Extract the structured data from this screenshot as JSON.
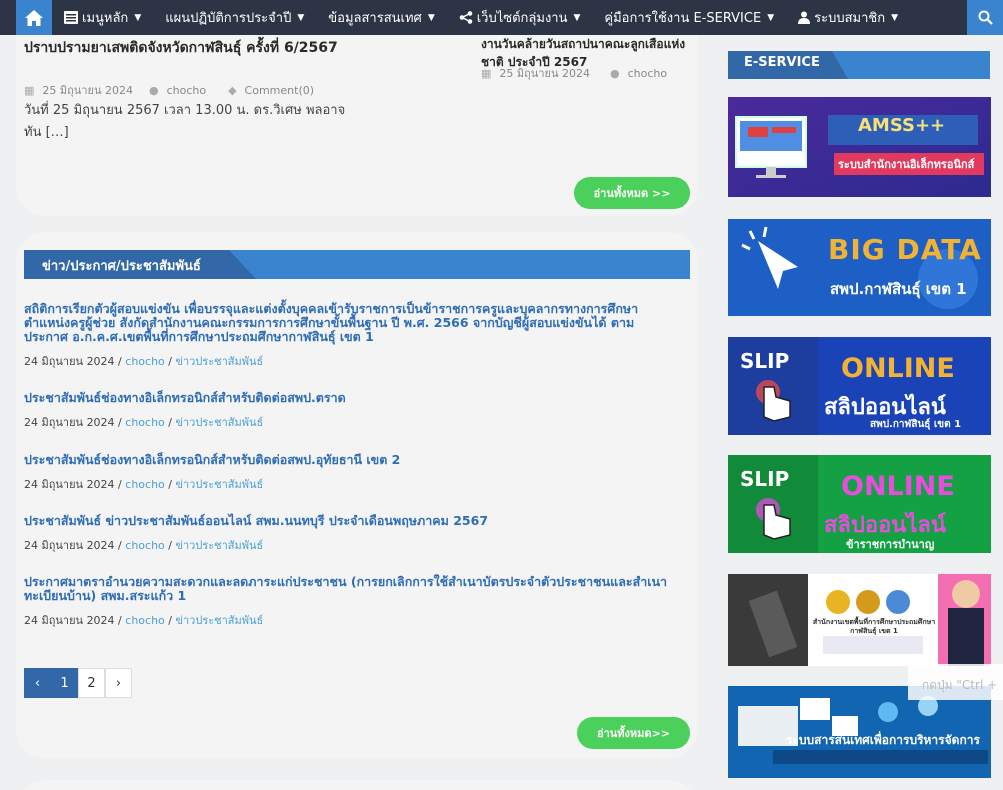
{
  "nav": {
    "items": [
      {
        "label": "เมนูหลัก",
        "icon": "list-icon"
      },
      {
        "label": "แผนปฏิบัติการประจำปี"
      },
      {
        "label": "ข้อมูลสารสนเทศ"
      },
      {
        "label": "เว็บไซต์กลุ่มงาน",
        "icon": "share-icon"
      },
      {
        "label": "คู่มือการใช้งาน E-SERVICE"
      },
      {
        "label": "ระบบสมาชิก",
        "icon": "user-icon"
      }
    ]
  },
  "top": {
    "left_title": "ปราบปรามยาเสพติดจังหวัดกาฬสินธุ์ ครั้งที่ 6/2567",
    "left_date": "25 มิถุนายน 2024",
    "left_author": "chocho",
    "left_comment": "Comment(0)",
    "left_excerpt": "วันที่ 25 มิถุนายน 2567 เวลา 13.00 น. ดร.วิเศษ พลอาจ ทัน […]",
    "right_title": "งานวันคล้ายวันสถาปนาคณะลูกเสือแห่งชาติ ประจำปี 2567",
    "right_date": "25 มิถุนายน 2024",
    "right_author": "chocho",
    "read_all": "อ่านทั้งหมด >>"
  },
  "news_section": {
    "title": "ข่าว/ประกาศ/ประชาสัมพันธ์",
    "items": [
      {
        "title": "สถิติการเรียกตัวผู้สอบแข่งขัน เพื่อบรรจุและแต่งตั้งบุคคลเข้ารับราชการเป็นข้าราชการครูและบุคลากรทางการศึกษา ตำแหน่งครูผู้ช่วย สังกัดสำนักงานคณะกรรมการการศึกษาขั้นพื้นฐาน ปี พ.ศ. 2566 จากบัญชีผู้สอบแข่งขันได้ ตามประกาศ อ.ก.ค.ศ.เขตพื้นที่การศึกษาประถมศึกษากาฬสินธุ์ เขต 1",
        "date": "24 มิถุนายน 2024",
        "author": "chocho",
        "category": "ข่าวประชาสัมพันธ์"
      },
      {
        "title": "ประชาสัมพันธ์ช่องทางอิเล็กทรอนิกส์สำหรับติดต่อสพป.ตราด",
        "date": "24 มิถุนายน 2024",
        "author": "chocho",
        "category": "ข่าวประชาสัมพันธ์"
      },
      {
        "title": "ประชาสัมพันธ์ช่องทางอิเล็กทรอนิกส์สำหรับติดต่อสพป.อุทัยธานี เขต 2",
        "date": "24 มิถุนายน 2024",
        "author": "chocho",
        "category": "ข่าวประชาสัมพันธ์"
      },
      {
        "title": "ประชาสัมพันธ์ ข่าวประชาสัมพันธ์ออนไลน์ สพม.นนทบุรี ประจำเดือนพฤษภาคม 2567",
        "date": "24 มิถุนายน 2024",
        "author": "chocho",
        "category": "ข่าวประชาสัมพันธ์"
      },
      {
        "title": "ประกาศมาตราอำนวยความสะดวกและลดภาระแก่ประชาชน (การยกเลิกการใช้สำเนาบัตรประจำตัวประชาชนและสำเนาทะเบียนบ้าน) สพม.สระแก้ว 1",
        "date": "24 มิถุนายน 2024",
        "author": "chocho",
        "category": "ข่าวประชาสัมพันธ์"
      }
    ],
    "pager": {
      "prev": "‹",
      "pages": [
        "1",
        "2"
      ],
      "next": "›"
    },
    "read_all": "อ่านทั้งหมด>>"
  },
  "sidebar": {
    "title": "E-SERVICE",
    "banners": {
      "amss_title": "AMSS++",
      "amss_sub": "ระบบสำนักงานอิเล็กทรอนิกส์",
      "bigdata_title": "BIG DATA",
      "bigdata_sub": "สพป.กาฬสินธุ์ เขต 1",
      "slip1_en": "SLIP",
      "slip1_online": "ONLINE",
      "slip1_th": "สลิปออนไลน์",
      "slip1_sub": "สพป.กาฬสินธุ์ เขต 1",
      "slip2_en": "SLIP",
      "slip2_online": "ONLINE",
      "slip2_th": "สลิปออนไลน์",
      "slip2_sub": "ข้าราชการบำนาญ",
      "office_text": "สำนักงานเขตพื้นที่การศึกษาประถมศึกษากาฬสินธุ์ เขต 1",
      "info_text": "ระบบสารสนเทศเพื่อการบริหารจัดการ"
    }
  },
  "watermark": "กดปุ่ม \"Ctrl +"
}
